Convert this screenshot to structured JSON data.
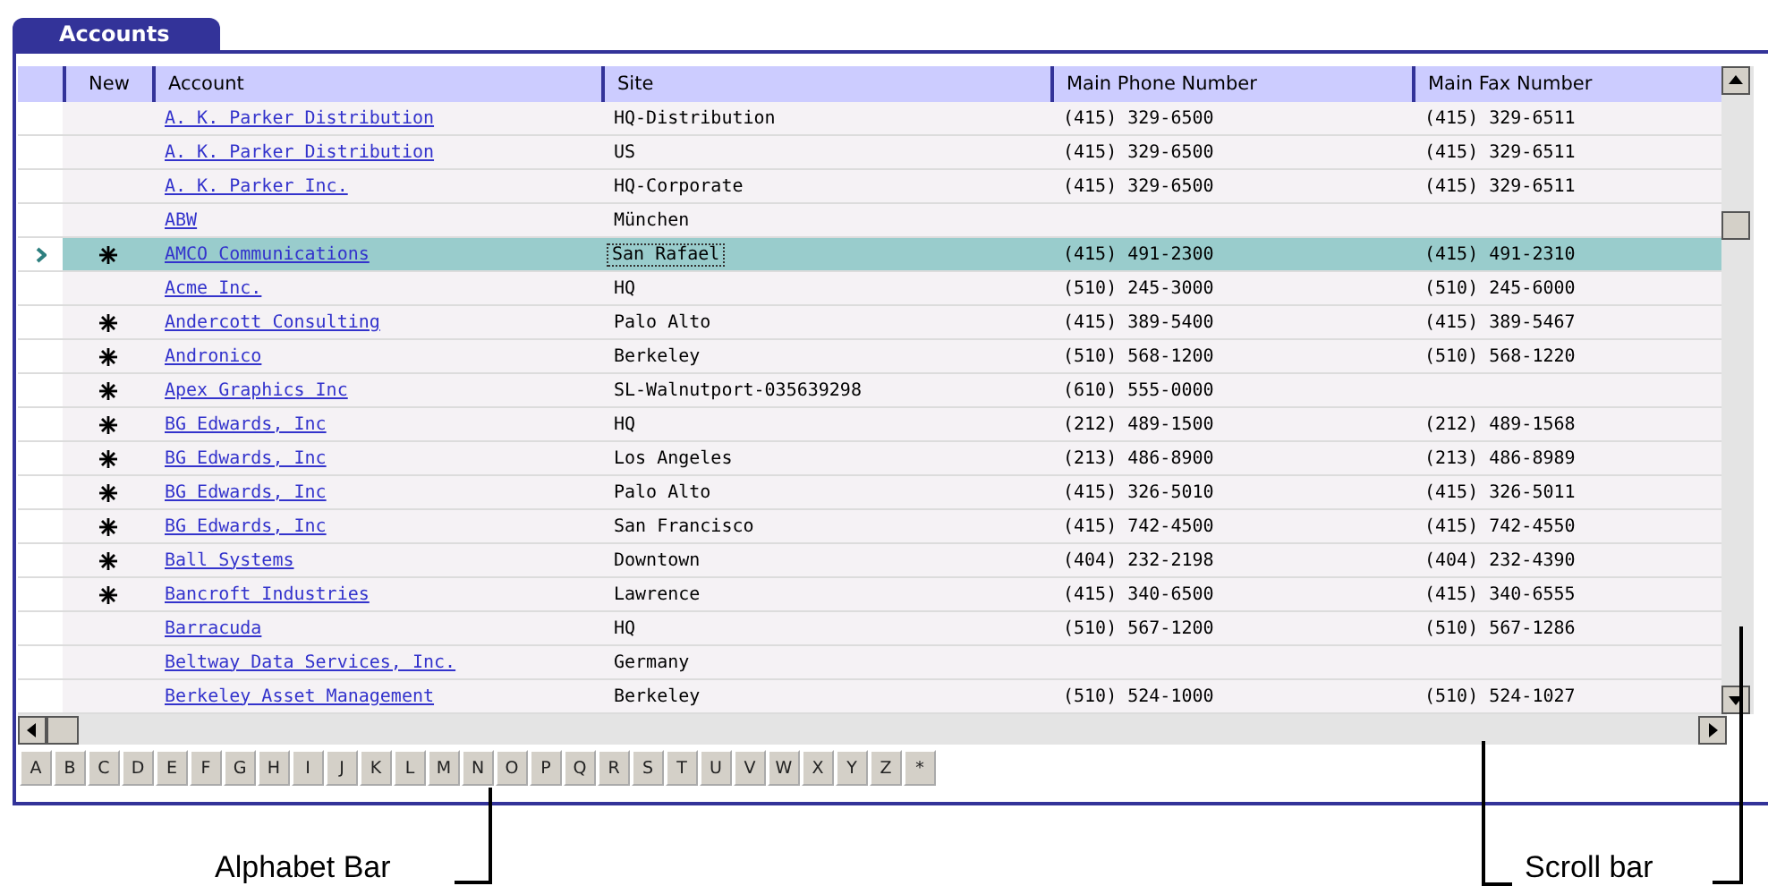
{
  "panel": {
    "title": "Accounts"
  },
  "table": {
    "columns": [
      "New",
      "Account",
      "Site",
      "Main Phone Number",
      "Main Fax Number"
    ],
    "rows": [
      {
        "new": false,
        "selected": false,
        "account": "A. K. Parker Distribution",
        "site": "HQ-Distribution",
        "phone": "(415) 329-6500",
        "fax": "(415) 329-6511"
      },
      {
        "new": false,
        "selected": false,
        "account": "A. K. Parker Distribution",
        "site": "US",
        "phone": "(415) 329-6500",
        "fax": "(415) 329-6511"
      },
      {
        "new": false,
        "selected": false,
        "account": "A. K. Parker Inc.",
        "site": "HQ-Corporate",
        "phone": "(415) 329-6500",
        "fax": "(415) 329-6511"
      },
      {
        "new": false,
        "selected": false,
        "account": "ABW",
        "site": "München",
        "phone": "",
        "fax": ""
      },
      {
        "new": true,
        "selected": true,
        "account": "AMCO Communications",
        "site": "San Rafael",
        "phone": "(415) 491-2300",
        "fax": "(415) 491-2310"
      },
      {
        "new": false,
        "selected": false,
        "account": "Acme Inc.",
        "site": "HQ",
        "phone": "(510) 245-3000",
        "fax": "(510) 245-6000"
      },
      {
        "new": true,
        "selected": false,
        "account": "Andercott Consulting",
        "site": "Palo Alto",
        "phone": "(415) 389-5400",
        "fax": "(415) 389-5467"
      },
      {
        "new": true,
        "selected": false,
        "account": "Andronico",
        "site": "Berkeley",
        "phone": "(510) 568-1200",
        "fax": "(510) 568-1220"
      },
      {
        "new": true,
        "selected": false,
        "account": "Apex Graphics Inc",
        "site": "SL-Walnutport-035639298",
        "phone": "(610) 555-0000",
        "fax": ""
      },
      {
        "new": true,
        "selected": false,
        "account": "BG Edwards, Inc",
        "site": "HQ",
        "phone": "(212) 489-1500",
        "fax": "(212) 489-1568"
      },
      {
        "new": true,
        "selected": false,
        "account": "BG Edwards, Inc",
        "site": "Los Angeles",
        "phone": "(213) 486-8900",
        "fax": "(213) 486-8989"
      },
      {
        "new": true,
        "selected": false,
        "account": "BG Edwards, Inc",
        "site": "Palo Alto",
        "phone": "(415) 326-5010",
        "fax": "(415) 326-5011"
      },
      {
        "new": true,
        "selected": false,
        "account": "BG Edwards, Inc",
        "site": "San Francisco",
        "phone": "(415) 742-4500",
        "fax": "(415) 742-4550"
      },
      {
        "new": true,
        "selected": false,
        "account": "Ball Systems",
        "site": "Downtown",
        "phone": "(404) 232-2198",
        "fax": "(404) 232-4390"
      },
      {
        "new": true,
        "selected": false,
        "account": "Bancroft Industries",
        "site": "Lawrence",
        "phone": "(415) 340-6500",
        "fax": "(415) 340-6555"
      },
      {
        "new": false,
        "selected": false,
        "account": "Barracuda",
        "site": "HQ",
        "phone": "(510) 567-1200",
        "fax": "(510) 567-1286"
      },
      {
        "new": false,
        "selected": false,
        "account": "Beltway Data Services, Inc.",
        "site": "Germany",
        "phone": "",
        "fax": ""
      },
      {
        "new": false,
        "selected": false,
        "account": "Berkeley Asset Management",
        "site": "Berkeley",
        "phone": "(510) 524-1000",
        "fax": "(510) 524-1027"
      }
    ]
  },
  "alphabet_bar": [
    "A",
    "B",
    "C",
    "D",
    "E",
    "F",
    "G",
    "H",
    "I",
    "J",
    "K",
    "L",
    "M",
    "N",
    "O",
    "P",
    "Q",
    "R",
    "S",
    "T",
    "U",
    "V",
    "W",
    "X",
    "Y",
    "Z",
    "*"
  ],
  "callouts": [
    {
      "kind": "alphabet",
      "text": "Alphabet Bar"
    },
    {
      "kind": "scroll",
      "text": "Scroll bar"
    }
  ]
}
